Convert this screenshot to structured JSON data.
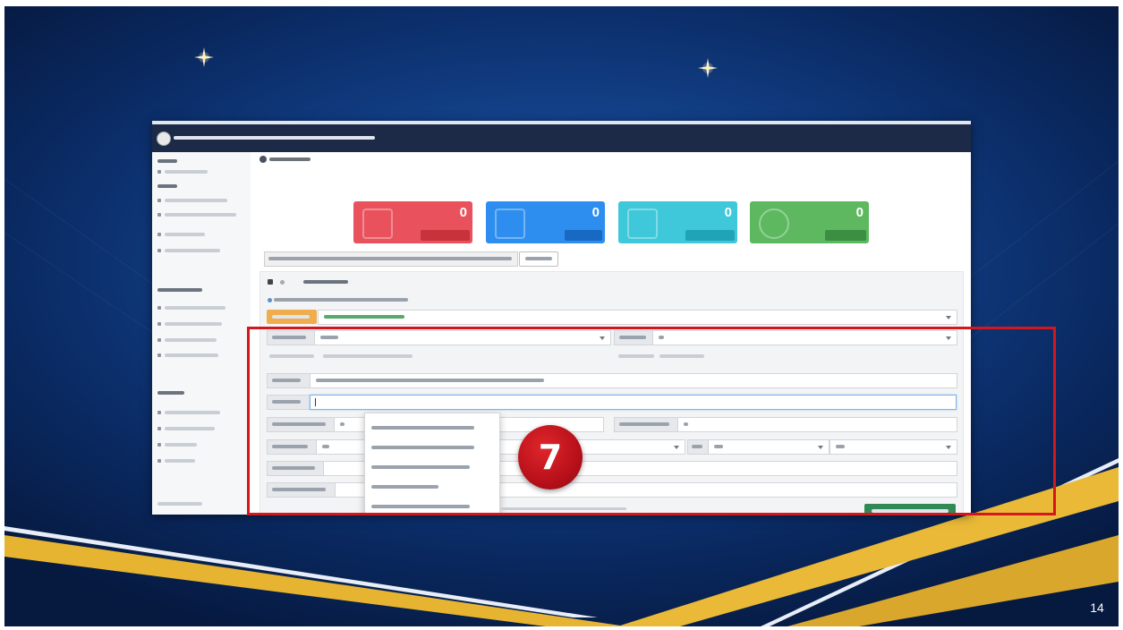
{
  "slide": {
    "page_number": "14",
    "background_color": "#0b2a63",
    "accent_gold": "#e9b937"
  },
  "step_badge": {
    "number": "7",
    "color": "#c0141b"
  },
  "highlight_box": {
    "color": "#d3171c"
  },
  "dashboard": {
    "cards": [
      {
        "value": "0",
        "color": "#e9525c",
        "icon": "chart-icon"
      },
      {
        "value": "0",
        "color": "#2d8ef0",
        "icon": "report-icon"
      },
      {
        "value": "0",
        "color": "#3fc8da",
        "icon": "bar-chart-icon"
      },
      {
        "value": "0",
        "color": "#5db860",
        "icon": "users-icon"
      }
    ]
  }
}
